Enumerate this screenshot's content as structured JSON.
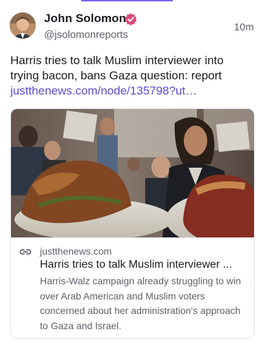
{
  "post": {
    "author_name": "John Solomon",
    "author_handle": "@jsolomonreports",
    "timestamp": "10m",
    "verified": true,
    "text": "Harris tries to talk Muslim interviewer into trying bacon, bans Gaza question: report",
    "link_text": "justthenews.com/node/135798?ut…"
  },
  "link_card": {
    "domain": "justthenews.com",
    "title": "Harris tries to talk Muslim interviewer ...",
    "description": "Harris-Walz campaign already struggling to win over Arab American and Muslim voters concerned about her administration's approach to Gaza and Israel."
  },
  "colors": {
    "accent": "#7b61ff",
    "link": "#5b4bd6",
    "verified_badge": "#e0477a"
  }
}
